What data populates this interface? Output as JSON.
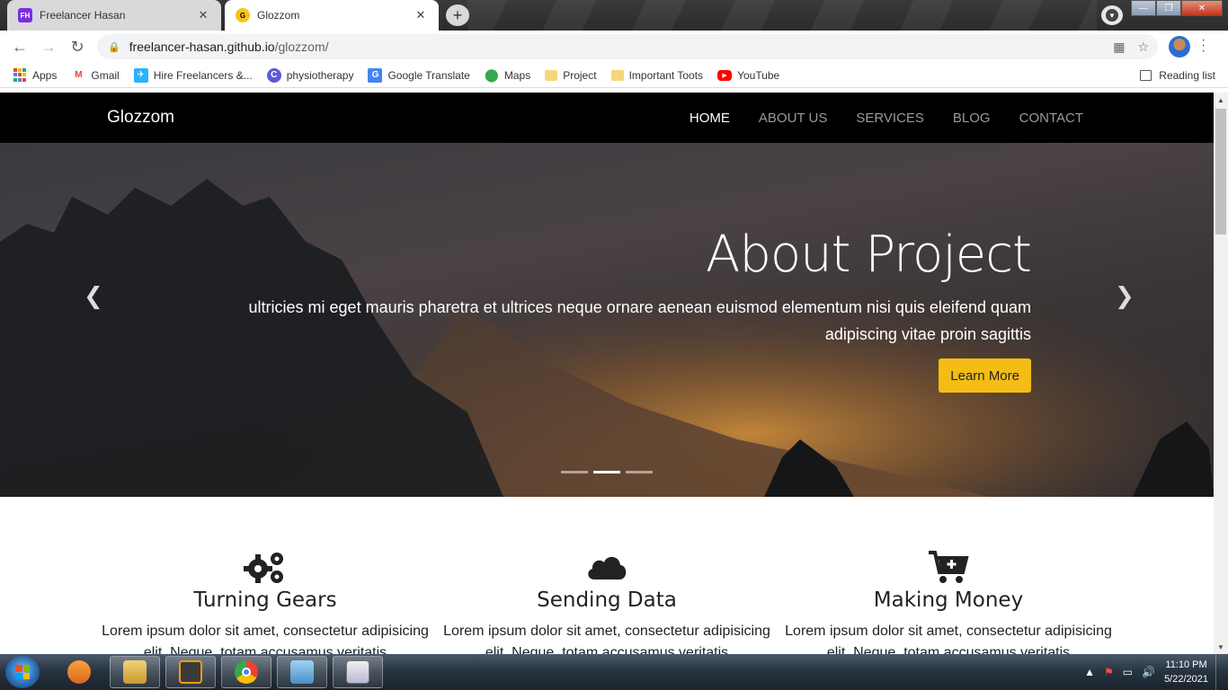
{
  "browser": {
    "tabs": [
      {
        "label": "Freelancer Hasan",
        "favicon": "FH"
      },
      {
        "label": "Glozzom",
        "favicon": "G"
      }
    ],
    "new_tab_label": "+",
    "url_host": "freelancer-hasan.github.io",
    "url_path": "/glozzom/",
    "bookmarks": [
      {
        "label": "Apps",
        "icon": "apps-grid-icon"
      },
      {
        "label": "Gmail",
        "icon": "gmail-icon"
      },
      {
        "label": "Hire Freelancers &...",
        "icon": "freelancer-bird-icon"
      },
      {
        "label": "physiotherapy",
        "icon": "c-circle-icon"
      },
      {
        "label": "Google Translate",
        "icon": "translate-icon"
      },
      {
        "label": "Maps",
        "icon": "maps-pin-icon"
      },
      {
        "label": "Project",
        "icon": "folder-icon"
      },
      {
        "label": "Important Toots",
        "icon": "folder-icon"
      },
      {
        "label": "YouTube",
        "icon": "youtube-icon"
      }
    ],
    "reading_list": "Reading list"
  },
  "site": {
    "brand": "Glozzom",
    "nav": [
      "HOME",
      "ABOUT US",
      "SERVICES",
      "BLOG",
      "CONTACT"
    ],
    "active_nav": "HOME",
    "hero": {
      "title": "About Project",
      "text": "ultricies mi eget mauris pharetra et ultrices neque ornare aenean euismod elementum nisi quis eleifend quam adipiscing vitae proin sagittis",
      "button": "Learn More",
      "slides": 3,
      "active_slide": 2
    },
    "features": [
      {
        "icon": "gears-icon",
        "title": "Turning Gears",
        "text": "Lorem ipsum dolor sit amet, consectetur adipisicing elit. Neque, totam accusamus veritatis"
      },
      {
        "icon": "cloud-icon",
        "title": "Sending Data",
        "text": "Lorem ipsum dolor sit amet, consectetur adipisicing elit. Neque, totam accusamus veritatis"
      },
      {
        "icon": "cart-plus-icon",
        "title": "Making Money",
        "text": "Lorem ipsum dolor sit amet, consectetur adipisicing elit. Neque, totam accusamus veritatis"
      }
    ]
  },
  "taskbar": {
    "time": "11:10 PM",
    "date": "5/22/2021"
  },
  "colors": {
    "accent_button": "#f4bc14",
    "navbar": "#000000"
  }
}
